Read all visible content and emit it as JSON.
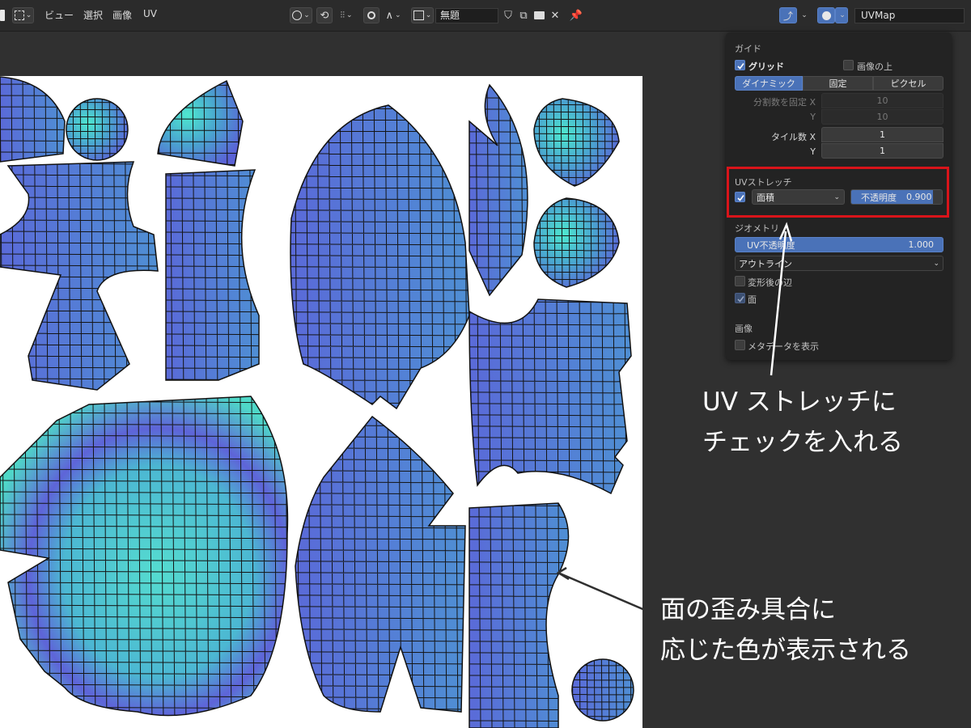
{
  "header": {
    "menu": [
      "ビュー",
      "選択",
      "画像",
      "UV"
    ],
    "image_name": "無題",
    "uv_map": "UVMap"
  },
  "overlay": {
    "guides": {
      "title": "ガイド",
      "grid_label": "グリッド",
      "grid_checked": true,
      "over_image_label": "画像の上",
      "over_image_checked": false,
      "modes": [
        "ダイナミック",
        "固定",
        "ピクセル"
      ],
      "active_mode": "ダイナミック",
      "fixed_subdivisions_label": "分割数を固定 X",
      "y_label": "Y",
      "subdiv_x": "10",
      "subdiv_y": "10",
      "tiles_label": "タイル数 X",
      "tiles_x": "1",
      "tiles_y": "1"
    },
    "uv_stretch": {
      "title": "UVストレッチ",
      "checked": true,
      "type": "面積",
      "opacity_label": "不透明度",
      "opacity": "0.900",
      "opacity_fraction": 0.9
    },
    "geometry": {
      "title": "ジオメトリ",
      "uv_opacity_label": "UV不透明度",
      "uv_opacity": "1.000",
      "display_mode": "アウトライン",
      "modified_edges_label": "変形後の辺",
      "modified_edges_checked": false,
      "faces_label": "面",
      "faces_checked": true
    },
    "image": {
      "title": "画像",
      "show_metadata_label": "メタデータを表示",
      "show_metadata_checked": false
    }
  },
  "annotations": {
    "top_line1": "UV ストレッチに",
    "top_line2": "チェックを入れる",
    "bottom_line1": "面の歪み具合に",
    "bottom_line2": "応じた色が表示される"
  },
  "colors": {
    "accent": "#4a72b8",
    "highlight": "#d9141a",
    "stretch_low": "#5b5fd6",
    "stretch_high": "#4fe0c8"
  }
}
